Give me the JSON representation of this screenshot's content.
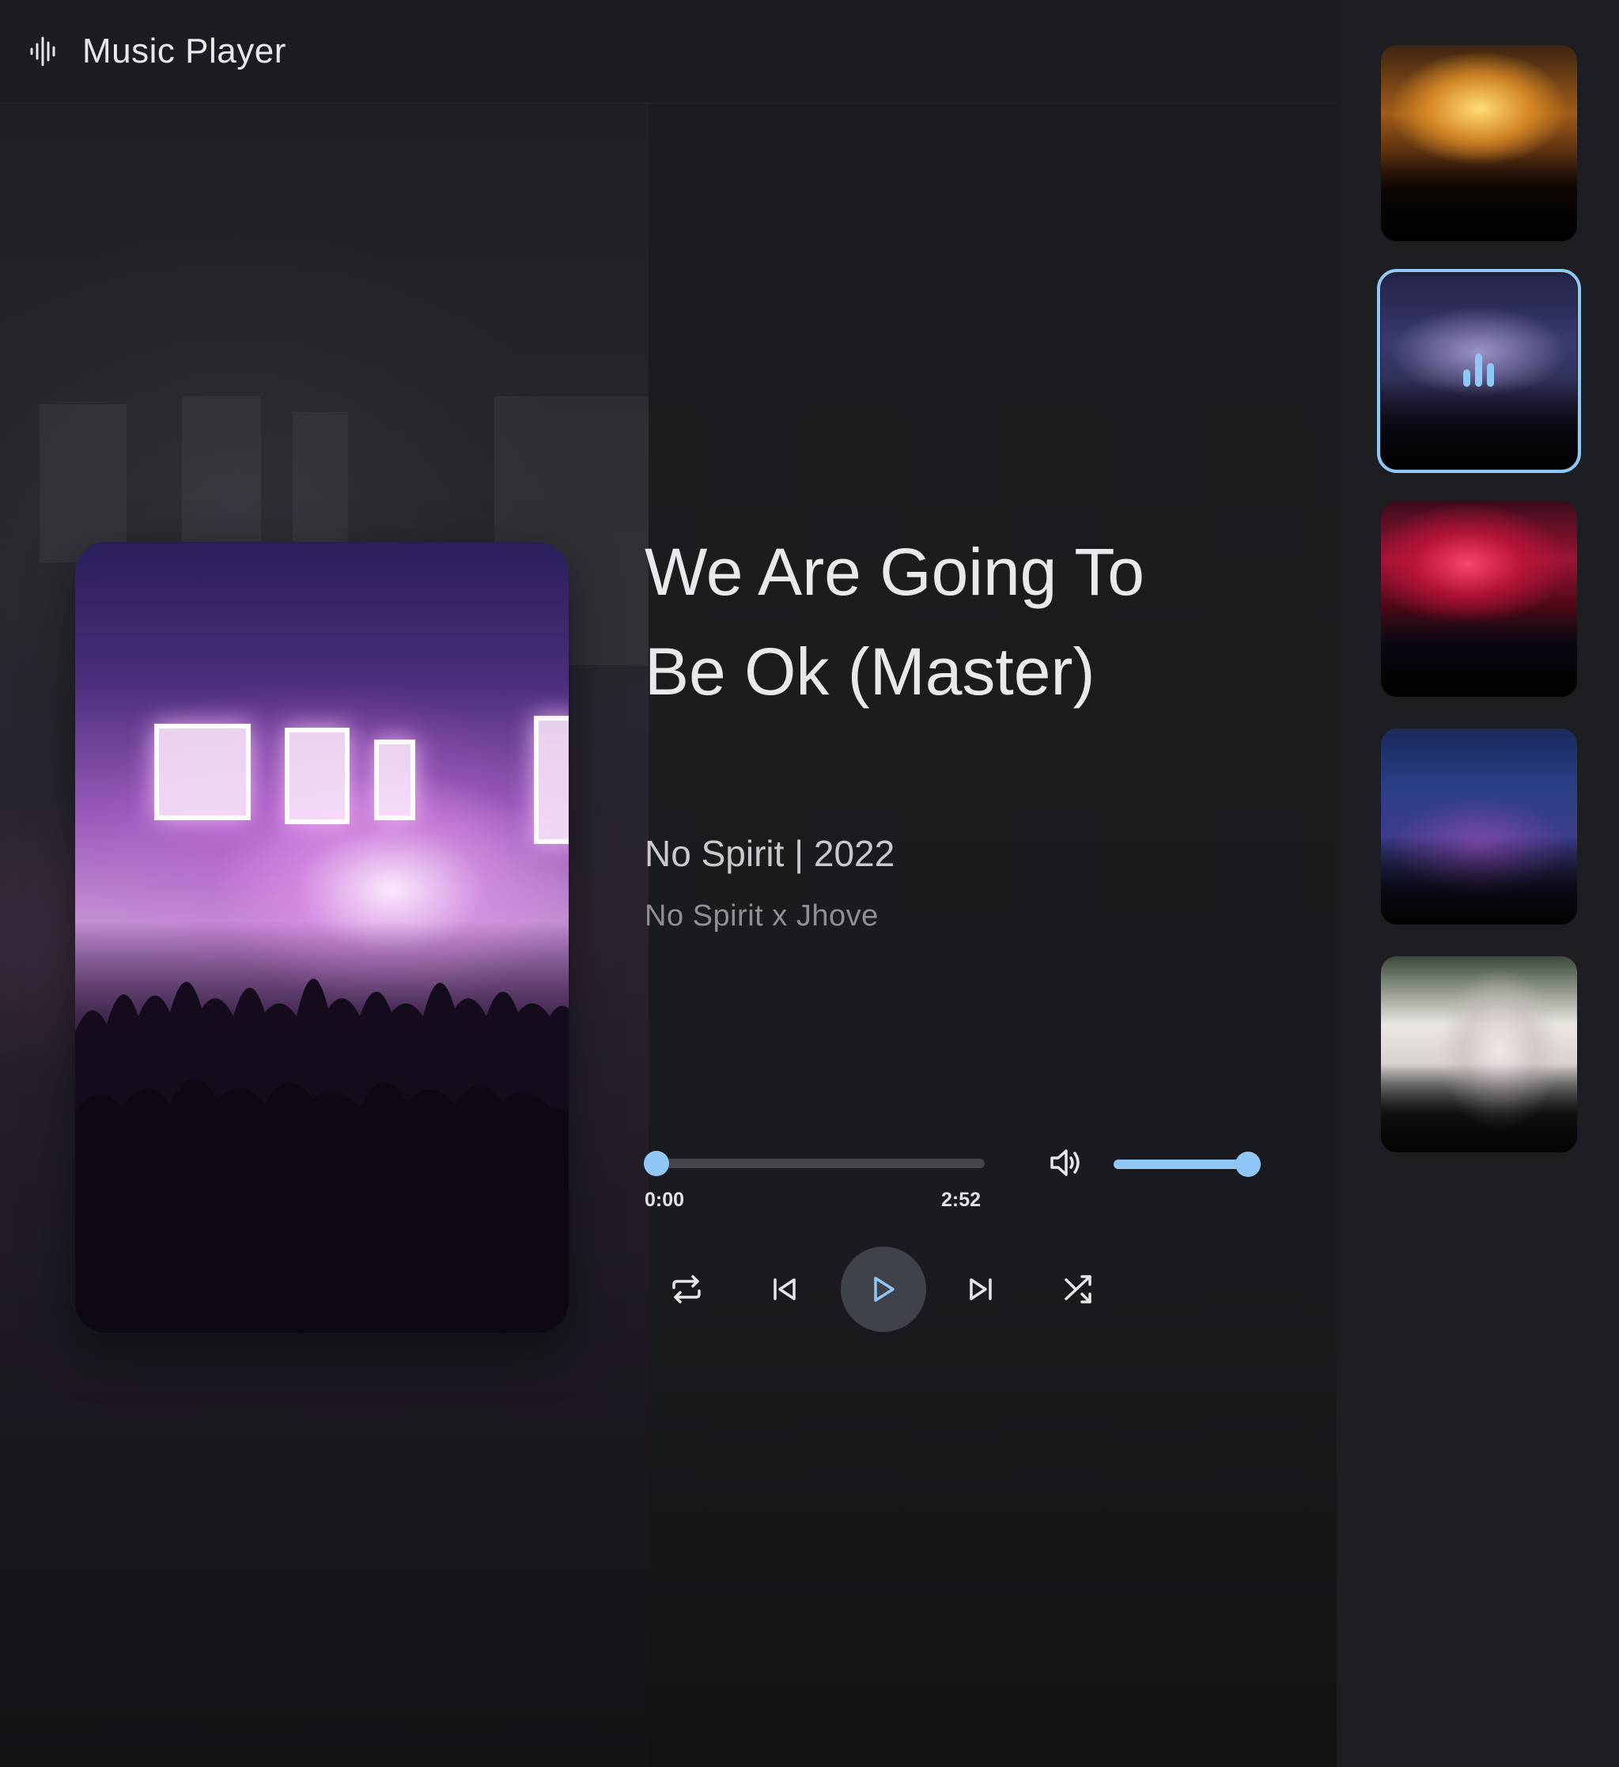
{
  "app": {
    "title": "Music Player",
    "logo_icon": "waveform-icon"
  },
  "track": {
    "title": "We Are Going To Be Ok (Master)",
    "meta": "No Spirit | 2022",
    "artists": "No Spirit x Jhove"
  },
  "progress": {
    "current_time": "0:00",
    "total_time": "2:52",
    "fraction": 0.0
  },
  "volume": {
    "fraction": 1.0,
    "icon": "volume-icon"
  },
  "controls": {
    "repeat": "repeat-icon",
    "previous": "skip-previous-icon",
    "play": "play-icon",
    "next": "skip-next-icon",
    "shuffle": "shuffle-icon"
  },
  "playlist": {
    "items": [
      {
        "art": "concert-golden-lights",
        "active": false
      },
      {
        "art": "concert-stage-screens",
        "active": true,
        "indicator": "equalizer-icon"
      },
      {
        "art": "concert-red-smoke",
        "active": false
      },
      {
        "art": "concert-blue-crowd",
        "active": false
      },
      {
        "art": "concert-singer-stage",
        "active": false
      }
    ]
  },
  "colors": {
    "accent": "#8fc7f6",
    "background": "#1b1c1e",
    "play_button_bg": "#3f4349",
    "track_inactive": "#44464b"
  }
}
